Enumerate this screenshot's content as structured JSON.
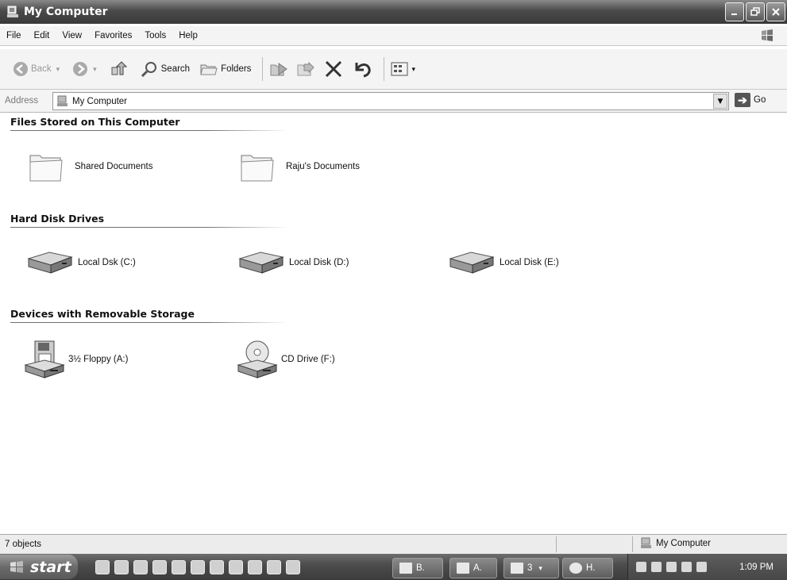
{
  "window": {
    "title": "My Computer"
  },
  "menu": [
    "File",
    "Edit",
    "View",
    "Favorites",
    "Tools",
    "Help"
  ],
  "toolbar": {
    "back_label": "Back",
    "search_label": "Search",
    "folders_label": "Folders"
  },
  "address": {
    "label": "Address",
    "value": "My Computer",
    "go_label": "Go"
  },
  "groups": {
    "files": {
      "title": "Files Stored on This Computer",
      "items": [
        "Shared Documents",
        "Raju's Documents"
      ]
    },
    "drives": {
      "title": "Hard Disk Drives",
      "items": [
        "Local Dsk (C:)",
        "Local Disk (D:)",
        "Local Disk (E:)"
      ]
    },
    "removable": {
      "title": "Devices with Removable Storage",
      "items": [
        "3½ Floppy (A:)",
        "CD Drive (F:)"
      ]
    }
  },
  "status": {
    "count": "7 objects",
    "location": "My Computer"
  },
  "taskbar": {
    "start_label": "start",
    "tasks": [
      "B.",
      "A.",
      "3",
      "H."
    ],
    "clock": "1:09 PM"
  }
}
